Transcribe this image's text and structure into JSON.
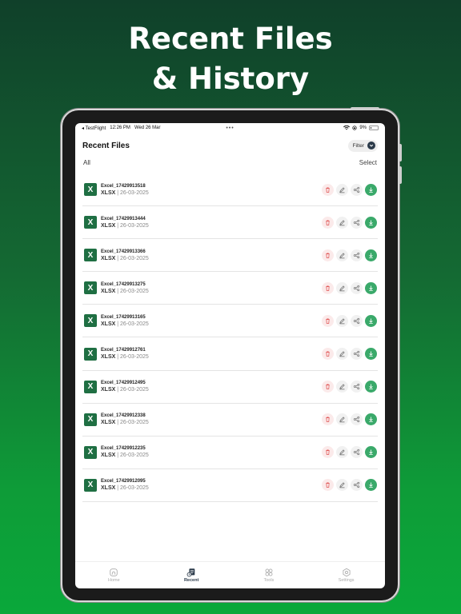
{
  "headline": {
    "line1": "Recent Files",
    "line2": "& History"
  },
  "status": {
    "carrier": "◂ TestFlight",
    "time": "12:26 PM",
    "date": "Wed 26 Mar",
    "dots": "•••",
    "battery": "9%"
  },
  "header": {
    "title": "Recent Files",
    "filter_label": "Filter"
  },
  "tabs": {
    "all": "All",
    "select": "Select"
  },
  "files": [
    {
      "name": "Excel_17429913518",
      "type": "XLSX",
      "date": "26-03-2025"
    },
    {
      "name": "Excel_17429913444",
      "type": "XLSX",
      "date": "26-03-2025"
    },
    {
      "name": "Excel_17429913366",
      "type": "XLSX",
      "date": "26-03-2025"
    },
    {
      "name": "Excel_17429913275",
      "type": "XLSX",
      "date": "26-03-2025"
    },
    {
      "name": "Excel_17429913165",
      "type": "XLSX",
      "date": "26-03-2025"
    },
    {
      "name": "Excel_17429912761",
      "type": "XLSX",
      "date": "26-03-2025"
    },
    {
      "name": "Excel_17429912495",
      "type": "XLSX",
      "date": "26-03-2025"
    },
    {
      "name": "Excel_17429912338",
      "type": "XLSX",
      "date": "26-03-2025"
    },
    {
      "name": "Excel_17429912235",
      "type": "XLSX",
      "date": "26-03-2025"
    },
    {
      "name": "Excel_17429912095",
      "type": "XLSX",
      "date": "26-03-2025"
    }
  ],
  "file_icon_letter": "X",
  "nav": [
    {
      "label": "Home",
      "icon": "home-icon"
    },
    {
      "label": "Recent",
      "icon": "recent-icon",
      "active": true
    },
    {
      "label": "Tools",
      "icon": "tools-icon"
    },
    {
      "label": "Settings",
      "icon": "settings-icon"
    }
  ],
  "colors": {
    "excel_green": "#1f6f43",
    "download_green": "#3aa96a",
    "delete_red": "#e05555",
    "accent_dark": "#2b3a4a"
  }
}
